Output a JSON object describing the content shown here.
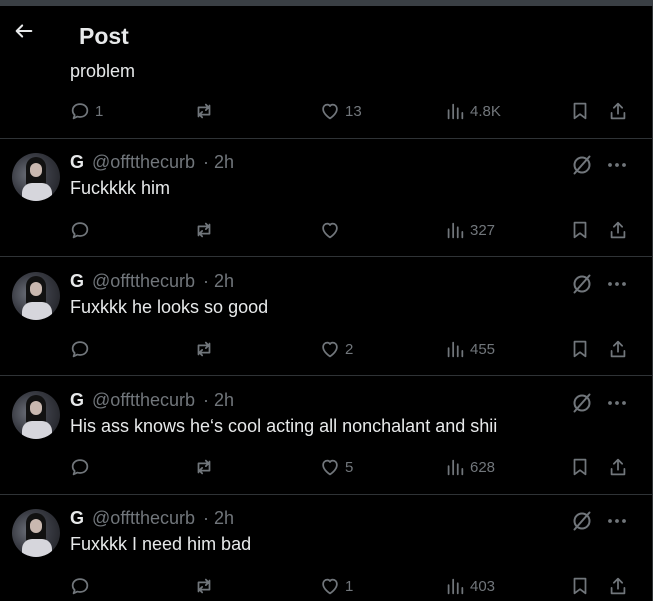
{
  "header": {
    "title": "Post"
  },
  "previous_post": {
    "text_fragment": "problem",
    "replies": "1",
    "likes": "13",
    "views": "4.8K"
  },
  "replies": [
    {
      "name": "G",
      "handle": "@offtthecurb",
      "time": "· 2h",
      "text": "Fuckkkk him",
      "replies": "",
      "reposts": "",
      "likes": "",
      "views": "327"
    },
    {
      "name": "G",
      "handle": "@offtthecurb",
      "time": "· 2h",
      "text": "Fuxkkk he looks so good",
      "replies": "",
      "reposts": "",
      "likes": "2",
      "views": "455"
    },
    {
      "name": "G",
      "handle": "@offtthecurb",
      "time": "· 2h",
      "text": "His ass knows he‘s cool acting all nonchalant and shii",
      "replies": "",
      "reposts": "",
      "likes": "5",
      "views": "628"
    },
    {
      "name": "G",
      "handle": "@offtthecurb",
      "time": "· 2h",
      "text": "Fuxkkk I need him bad",
      "replies": "",
      "reposts": "",
      "likes": "1",
      "views": "403"
    }
  ],
  "icons": {
    "back": "arrow-left-icon",
    "reply": "speech-bubble-icon",
    "repost": "repost-arrows-icon",
    "like": "heart-icon",
    "views": "bar-chart-icon",
    "bookmark": "bookmark-icon",
    "share": "share-upload-icon",
    "grok": "grok-slash-circle-icon",
    "more": "ellipsis-icon"
  },
  "colors": {
    "background": "#000000",
    "text": "#e7e9ea",
    "muted": "#71767b",
    "divider": "#2f3336"
  }
}
